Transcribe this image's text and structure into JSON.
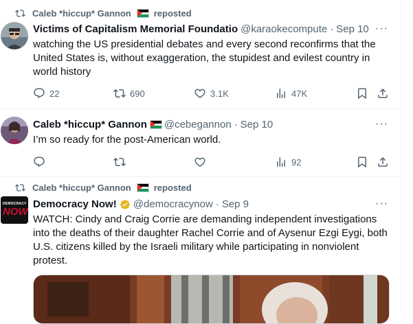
{
  "tweets": [
    {
      "repost_text": "Caleb *hiccup* Gannon",
      "repost_suffix": "reposted",
      "name": "Victims of Capitalism Memorial Foundatio",
      "handle": "@karaokecompute",
      "dot": "·",
      "date": "Sep 10",
      "more": "···",
      "body": "watching the US presidential debates and every second reconfirms that the United States is, without exaggeration, the stupidest and evilest country in world history",
      "replies": "22",
      "reposts": "690",
      "likes": "3.1K",
      "views": "47K"
    },
    {
      "name": "Caleb *hiccup* Gannon",
      "handle": "@cebegannon",
      "dot": "·",
      "date": "Sep 10",
      "more": "···",
      "body": "I’m so ready for the post-American world.",
      "replies": "",
      "reposts": "",
      "likes": "",
      "views": "92"
    },
    {
      "repost_text": "Caleb *hiccup* Gannon",
      "repost_suffix": "reposted",
      "name": "Democracy Now!",
      "handle": "@democracynow",
      "dot": "·",
      "date": "Sep 9",
      "more": "···",
      "avatar_text_top": "DEMOCRACY",
      "avatar_text_bottom": "NOW!",
      "body": "WATCH: Cindy and Craig Corrie are demanding independent investigations into the deaths of their daughter Rachel Corrie and of Aysenur Ezgi Eygi, both U.S. citizens killed by the Israeli military while participating in nonviolent protest."
    }
  ],
  "colors": {
    "text": "#0f1419",
    "muted": "#536471",
    "divider": "#eff3f4",
    "verified_gold": "#e2b719",
    "dn_red": "#c8102e"
  }
}
